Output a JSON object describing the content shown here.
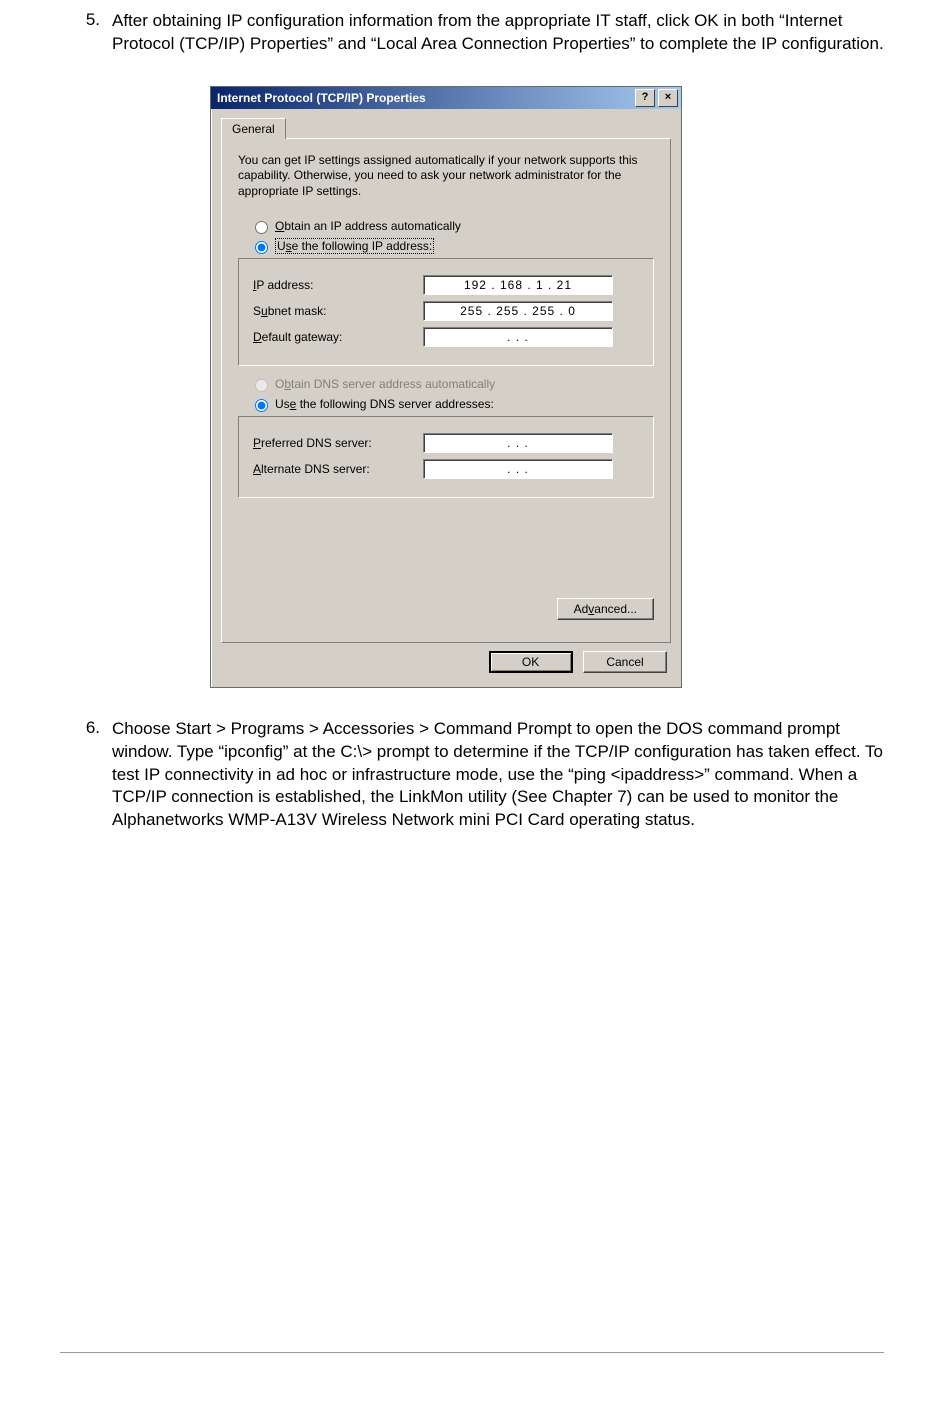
{
  "step5": {
    "num": "5.",
    "text": "After obtaining IP configuration information from the appropriate IT staff, click OK in both “Internet Protocol (TCP/IP) Properties” and “Local Area Connection Properties” to complete the IP configuration."
  },
  "step6": {
    "num": "6.",
    "text": "Choose Start > Programs > Accessories > Command Prompt to open the DOS command prompt window. Type “ipconfig” at the C:\\> prompt to determine if the TCP/IP configuration has taken effect. To test IP connectivity in ad hoc or infrastructure mode, use the “ping <ipaddress>” command. When a TCP/IP connection is established, the LinkMon utility (See Chapter 7) can be used to monitor the Alphanetworks WMP-A13V Wireless Network mini PCI Card operating status."
  },
  "dialog": {
    "title": "Internet Protocol (TCP/IP) Properties",
    "help_btn": "?",
    "close_btn": "×",
    "tab": "General",
    "desc": "You can get IP settings assigned automatically if your network supports this capability. Otherwise, you need to ask your network administrator for the appropriate IP settings.",
    "radio_obtain_ip": "Obtain an IP address automatically",
    "radio_use_ip": "Use the following IP address:",
    "label_ip": "IP address:",
    "label_subnet": "Subnet mask:",
    "label_gateway": "Default gateway:",
    "val_ip": "192 . 168 .   1   .  21",
    "val_subnet": "255 . 255 . 255 .   0",
    "val_gateway": ".        .        .",
    "radio_obtain_dns": "Obtain DNS server address automatically",
    "radio_use_dns": "Use the following DNS server addresses:",
    "label_pref_dns": "Preferred DNS server:",
    "label_alt_dns": "Alternate DNS server:",
    "val_pref_dns": ".        .        .",
    "val_alt_dns": ".        .        .",
    "btn_advanced": "Advanced...",
    "btn_ok": "OK",
    "btn_cancel": "Cancel"
  }
}
